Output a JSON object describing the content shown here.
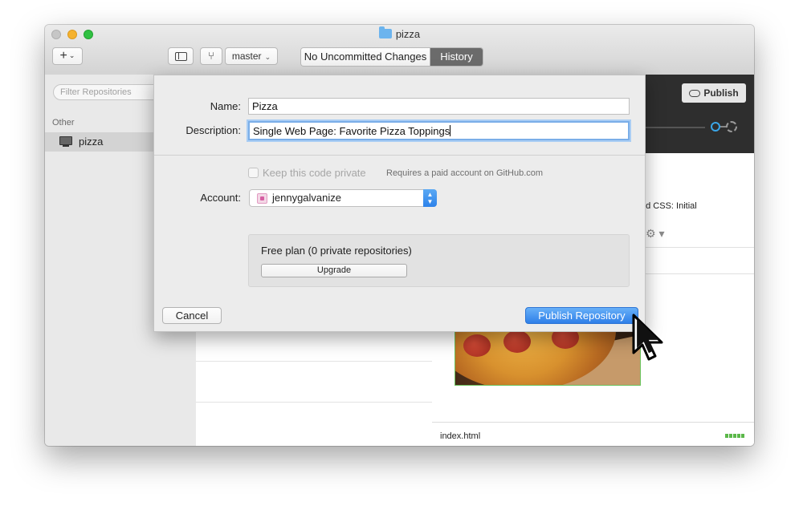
{
  "window": {
    "title": "pizza"
  },
  "toolbar": {
    "add_label": "+",
    "branch": "master",
    "segments": {
      "uncommitted": "No Uncommitted Changes",
      "history": "History"
    }
  },
  "sidebar": {
    "filter_placeholder": "Filter Repositories",
    "section_label": "Other",
    "repo": "pizza"
  },
  "detail": {
    "publish_label": "Publish",
    "commit_summary_fragment": "nd CSS: Initial",
    "file_name": "index.html"
  },
  "dialog": {
    "name_label": "Name:",
    "name_value": "Pizza",
    "description_label": "Description:",
    "description_value": "Single Web Page: Favorite Pizza Toppings",
    "private_label": "Keep this code private",
    "private_checked": false,
    "private_note": "Requires a paid account on GitHub.com",
    "account_label": "Account:",
    "account_value": "jennygalvanize",
    "plan_text": "Free plan (0 private repositories)",
    "upgrade_label": "Upgrade",
    "cancel_label": "Cancel",
    "publish_label": "Publish Repository"
  },
  "colors": {
    "accent_blue": "#2f7fe8",
    "history_segment": "#6b6b6b",
    "dark_panel": "#2e2e2e",
    "diff_green": "#5bb84a"
  }
}
